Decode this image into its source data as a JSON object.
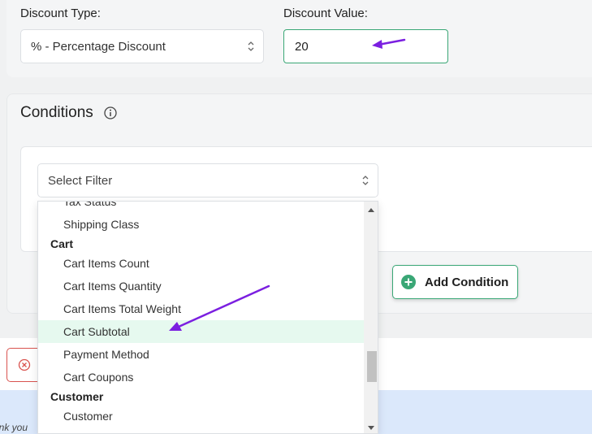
{
  "discount": {
    "type_label": "Discount Type:",
    "type_value": "% - Percentage Discount",
    "value_label": "Discount Value:",
    "value": "20"
  },
  "conditions": {
    "title": "Conditions",
    "filter_placeholder": "Select Filter",
    "add_button": "Add Condition"
  },
  "dropdown": {
    "items": [
      {
        "kind": "option",
        "label": "Tax Status"
      },
      {
        "kind": "option",
        "label": "Shipping Class"
      },
      {
        "kind": "group",
        "label": "Cart"
      },
      {
        "kind": "option",
        "label": "Cart Items Count"
      },
      {
        "kind": "option",
        "label": "Cart Items Quantity"
      },
      {
        "kind": "option",
        "label": "Cart Items Total Weight"
      },
      {
        "kind": "option",
        "label": "Cart Subtotal",
        "highlighted": true
      },
      {
        "kind": "option",
        "label": "Payment Method"
      },
      {
        "kind": "option",
        "label": "Cart Coupons"
      },
      {
        "kind": "group",
        "label": "Customer"
      },
      {
        "kind": "option",
        "label": "Customer"
      }
    ]
  },
  "footer": {
    "text": "ank you"
  },
  "colors": {
    "accent_green": "#3aa776",
    "highlight": "#e6f9ef",
    "annotation_arrow": "#7b1fe0",
    "cancel_red": "#d9534f"
  },
  "icons": [
    "chevron-updown-icon",
    "info-icon",
    "plus-circle-icon",
    "close-circle-icon",
    "arrow-annotation"
  ]
}
